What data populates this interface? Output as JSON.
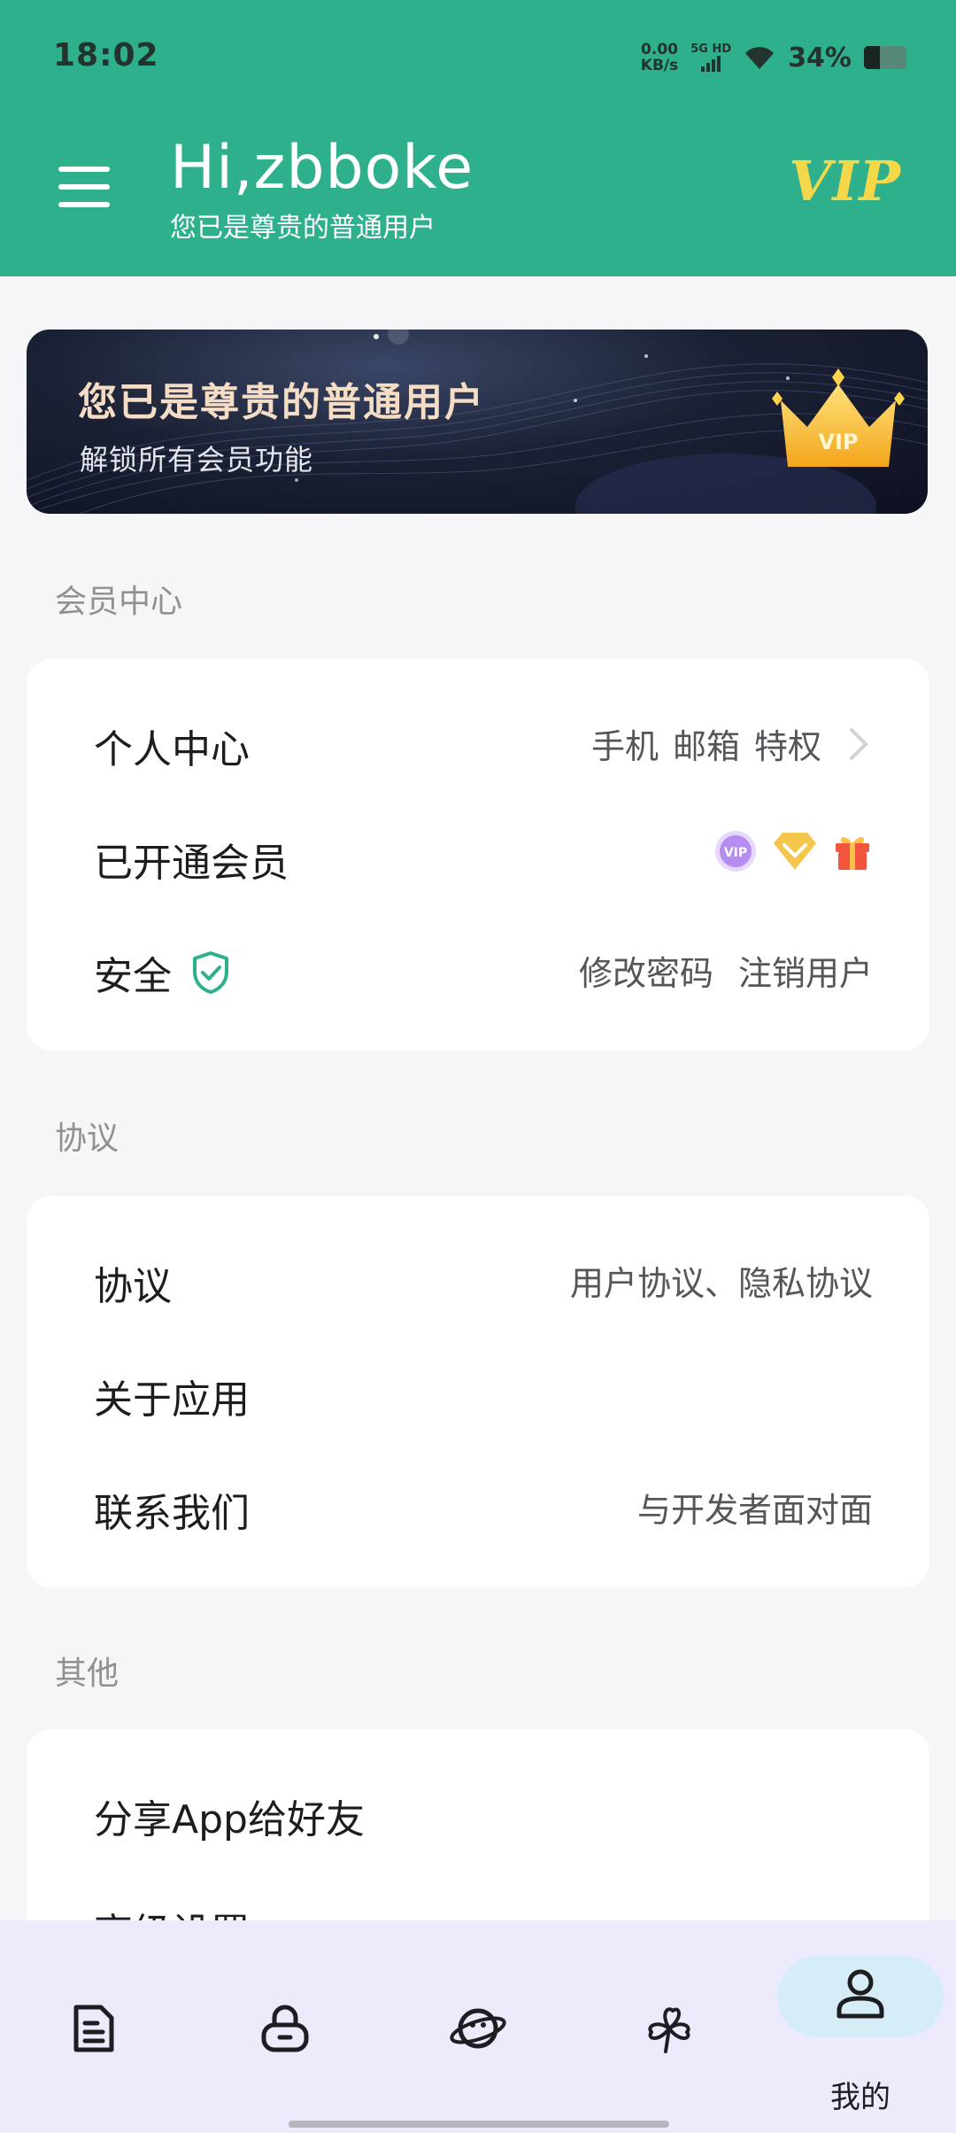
{
  "status_bar": {
    "time": "18:02",
    "net_speed_value": "0.00",
    "net_speed_unit": "KB/s",
    "network": "5G HD",
    "battery_percent": "34%",
    "battery_level": 0.34
  },
  "header": {
    "greeting": "Hi,zbboke",
    "subtitle": "您已是尊贵的普通用户",
    "vip_badge": "VIP",
    "background_color": "#2fb08d"
  },
  "banner": {
    "title": "您已是尊贵的普通用户",
    "subtitle": "解锁所有会员功能",
    "crown_label": "VIP"
  },
  "sections": {
    "member_center": {
      "title": "会员中心",
      "rows": {
        "personal": {
          "label": "个人中心",
          "values": [
            "手机",
            "邮箱",
            "特权"
          ]
        },
        "membership": {
          "label": "已开通会员",
          "badge_icons": [
            "vip-badge-icon",
            "diamond-icon",
            "gift-icon"
          ],
          "vip_text": "VIP"
        },
        "security": {
          "label": "安全",
          "values": [
            "修改密码",
            "注销用户"
          ]
        }
      }
    },
    "agreement": {
      "title": "协议",
      "rows": {
        "agreement": {
          "label": "协议",
          "value": "用户协议、隐私协议"
        },
        "about": {
          "label": "关于应用"
        },
        "contact": {
          "label": "联系我们",
          "value": "与开发者面对面"
        }
      }
    },
    "other": {
      "title": "其他",
      "rows": {
        "share": {
          "label": "分享App给好友"
        },
        "advanced": {
          "label": "高级设置"
        }
      }
    }
  },
  "bottom_nav": {
    "items": [
      {
        "icon": "document-icon",
        "label": ""
      },
      {
        "icon": "lock-icon",
        "label": ""
      },
      {
        "icon": "planet-icon",
        "label": ""
      },
      {
        "icon": "clover-icon",
        "label": ""
      },
      {
        "icon": "user-icon",
        "label": "我的",
        "active": true
      }
    ]
  }
}
